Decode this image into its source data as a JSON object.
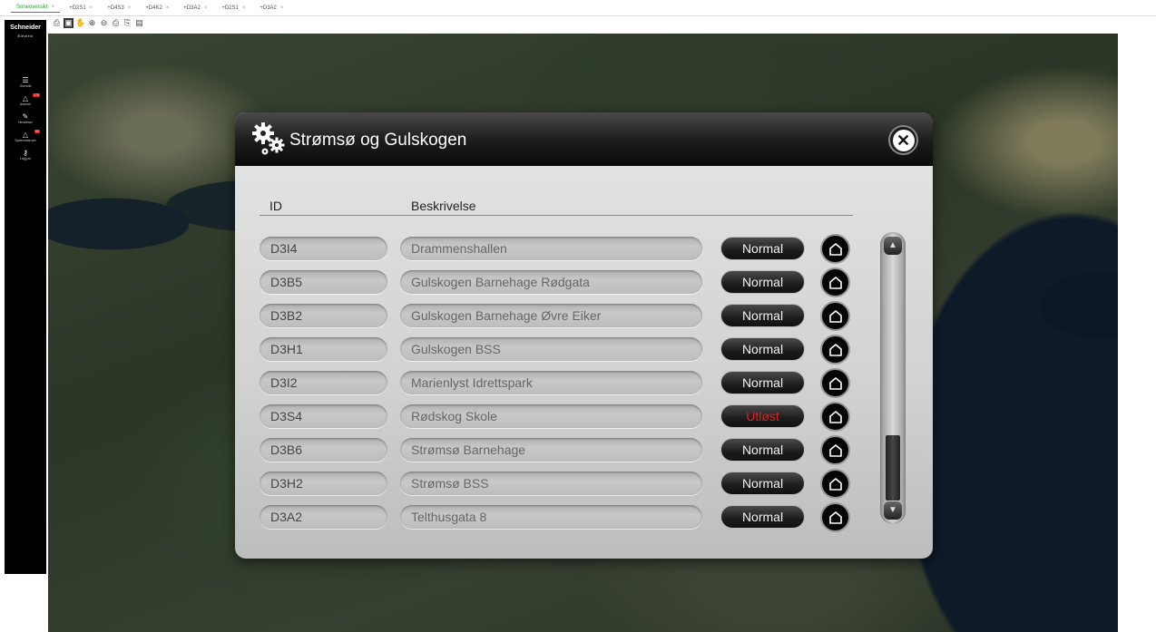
{
  "tabs": [
    {
      "label": "Soneoversikt"
    },
    {
      "label": "+D2S1"
    },
    {
      "label": "+D4S3"
    },
    {
      "label": "+D4K2"
    },
    {
      "label": "+D3A2"
    },
    {
      "label": "+D2S1"
    },
    {
      "label": "+D3A2"
    }
  ],
  "sidebar": {
    "logo": "Schneider",
    "logo_sub": "Electric",
    "items": [
      {
        "label": "Oversikt",
        "icon": "overview-icon",
        "badge": ""
      },
      {
        "label": "Alarmer",
        "icon": "bell-icon",
        "badge": "273"
      },
      {
        "label": "Hendelser",
        "icon": "pen-icon",
        "badge": ""
      },
      {
        "label": "Systemalarmer",
        "icon": "bell-icon",
        "badge": "63"
      },
      {
        "label": "Logg av",
        "icon": "key-icon",
        "badge": ""
      }
    ]
  },
  "toolbar": {
    "icons": [
      "select-icon",
      "pan-mode-icon",
      "hand-icon",
      "zoom-in-icon",
      "zoom-out-icon",
      "print-icon",
      "print-preview-icon",
      "page-icon"
    ]
  },
  "modal": {
    "title": "Strømsø og Gulskogen",
    "col_id": "ID",
    "col_desc": "Beskrivelse",
    "rows": [
      {
        "id": "D3I4",
        "desc": "Drammenshallen",
        "status": "Normal",
        "alarm": false
      },
      {
        "id": "D3B5",
        "desc": "Gulskogen Barnehage Rødgata",
        "status": "Normal",
        "alarm": false
      },
      {
        "id": "D3B2",
        "desc": "Gulskogen Barnehage Øvre Eiker",
        "status": "Normal",
        "alarm": false
      },
      {
        "id": "D3H1",
        "desc": "Gulskogen BSS",
        "status": "Normal",
        "alarm": false
      },
      {
        "id": "D3I2",
        "desc": "Marienlyst Idrettspark",
        "status": "Normal",
        "alarm": false
      },
      {
        "id": "D3S4",
        "desc": "Rødskog Skole",
        "status": "Utløst",
        "alarm": true
      },
      {
        "id": "D3B6",
        "desc": "Strømsø Barnehage",
        "status": "Normal",
        "alarm": false
      },
      {
        "id": "D3H2",
        "desc": "Strømsø BSS",
        "status": "Normal",
        "alarm": false
      },
      {
        "id": "D3A2",
        "desc": "Telthusgata 8",
        "status": "Normal",
        "alarm": false
      }
    ]
  },
  "colors": {
    "tab_active": "#2a9d3a",
    "status_alarm": "#e02020",
    "status_normal": "#f4f4f4"
  }
}
